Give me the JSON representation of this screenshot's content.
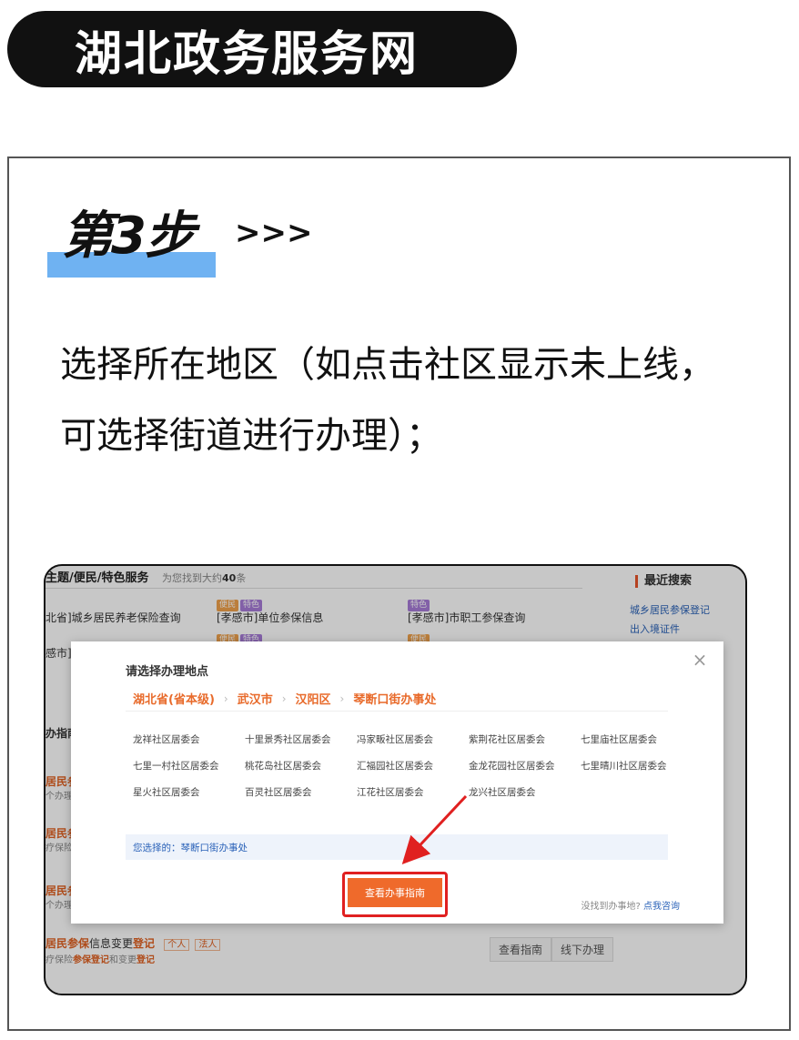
{
  "header": {
    "title": "湖北政务服务网"
  },
  "step": {
    "label": "第3步",
    "arrows": ">>>"
  },
  "instruction": "选择所在地区（如点击社区显示未上线，可选择街道进行办理）；",
  "background_page": {
    "section_title": "主题/便民/特色服务",
    "found_prefix": "为您找到大约",
    "found_count": "40",
    "found_suffix": "条",
    "row1_left": "北省]城乡居民养老保险查询",
    "row1_mid_tags": [
      "便民",
      "特色"
    ],
    "row1_mid": "[孝感市]单位参保信息",
    "row1_right_tag": "特色",
    "row1_right": "[孝感市]市职工参保查询",
    "row2_left": "感市]职",
    "row2_mid_tags": [
      "便民",
      "特色"
    ],
    "row2_right_tag": "便民",
    "guide_label": "办指南",
    "item_a_title": "居民参",
    "item_a_sub": "个办理",
    "item_b_title": "居民参",
    "item_b_sub": "疗保险",
    "item_c_title": "居民参",
    "item_c_sub": "个办理",
    "bottom_item_title_a": "居民参保",
    "bottom_item_title_b": "信息变更",
    "bottom_item_title_c": "登记",
    "bottom_tag_personal": "个人",
    "bottom_tag_legal": "法人",
    "bottom_item_sub_a": "疗保险",
    "bottom_item_sub_b": "参保登记",
    "bottom_item_sub_c": "和变更",
    "bottom_item_sub_d": "登记",
    "btn_view_guide": "查看指南",
    "btn_offline": "线下办理",
    "side_title": "最近搜索",
    "side_links": [
      "城乡居民参保登记",
      "出入境证件"
    ]
  },
  "modal": {
    "title": "请选择办理地点",
    "close_icon": "close-icon",
    "breadcrumbs": [
      "湖北省(省本级)",
      "武汉市",
      "汉阳区",
      "琴断口街办事处"
    ],
    "communities": [
      "龙祥社区居委会",
      "十里景秀社区居委会",
      "冯家畈社区居委会",
      "紫荆花社区居委会",
      "七里庙社区居委会",
      "七里一村社区居委会",
      "桃花岛社区居委会",
      "汇福园社区居委会",
      "金龙花园社区居委会",
      "七里晴川社区居委会",
      "星火社区居委会",
      "百灵社区居委会",
      "江花社区居委会",
      "龙兴社区居委会"
    ],
    "selected_text": "您选择的：琴断口街办事处",
    "primary_button": "查看办事指南",
    "help_prefix": "没找到办事地?",
    "help_link": "点我咨询"
  },
  "colors": {
    "accent_orange": "#ef6a2b",
    "highlight_red": "#e02020",
    "step_bar_blue": "#6fb2f2",
    "link_blue": "#2a62b8"
  }
}
